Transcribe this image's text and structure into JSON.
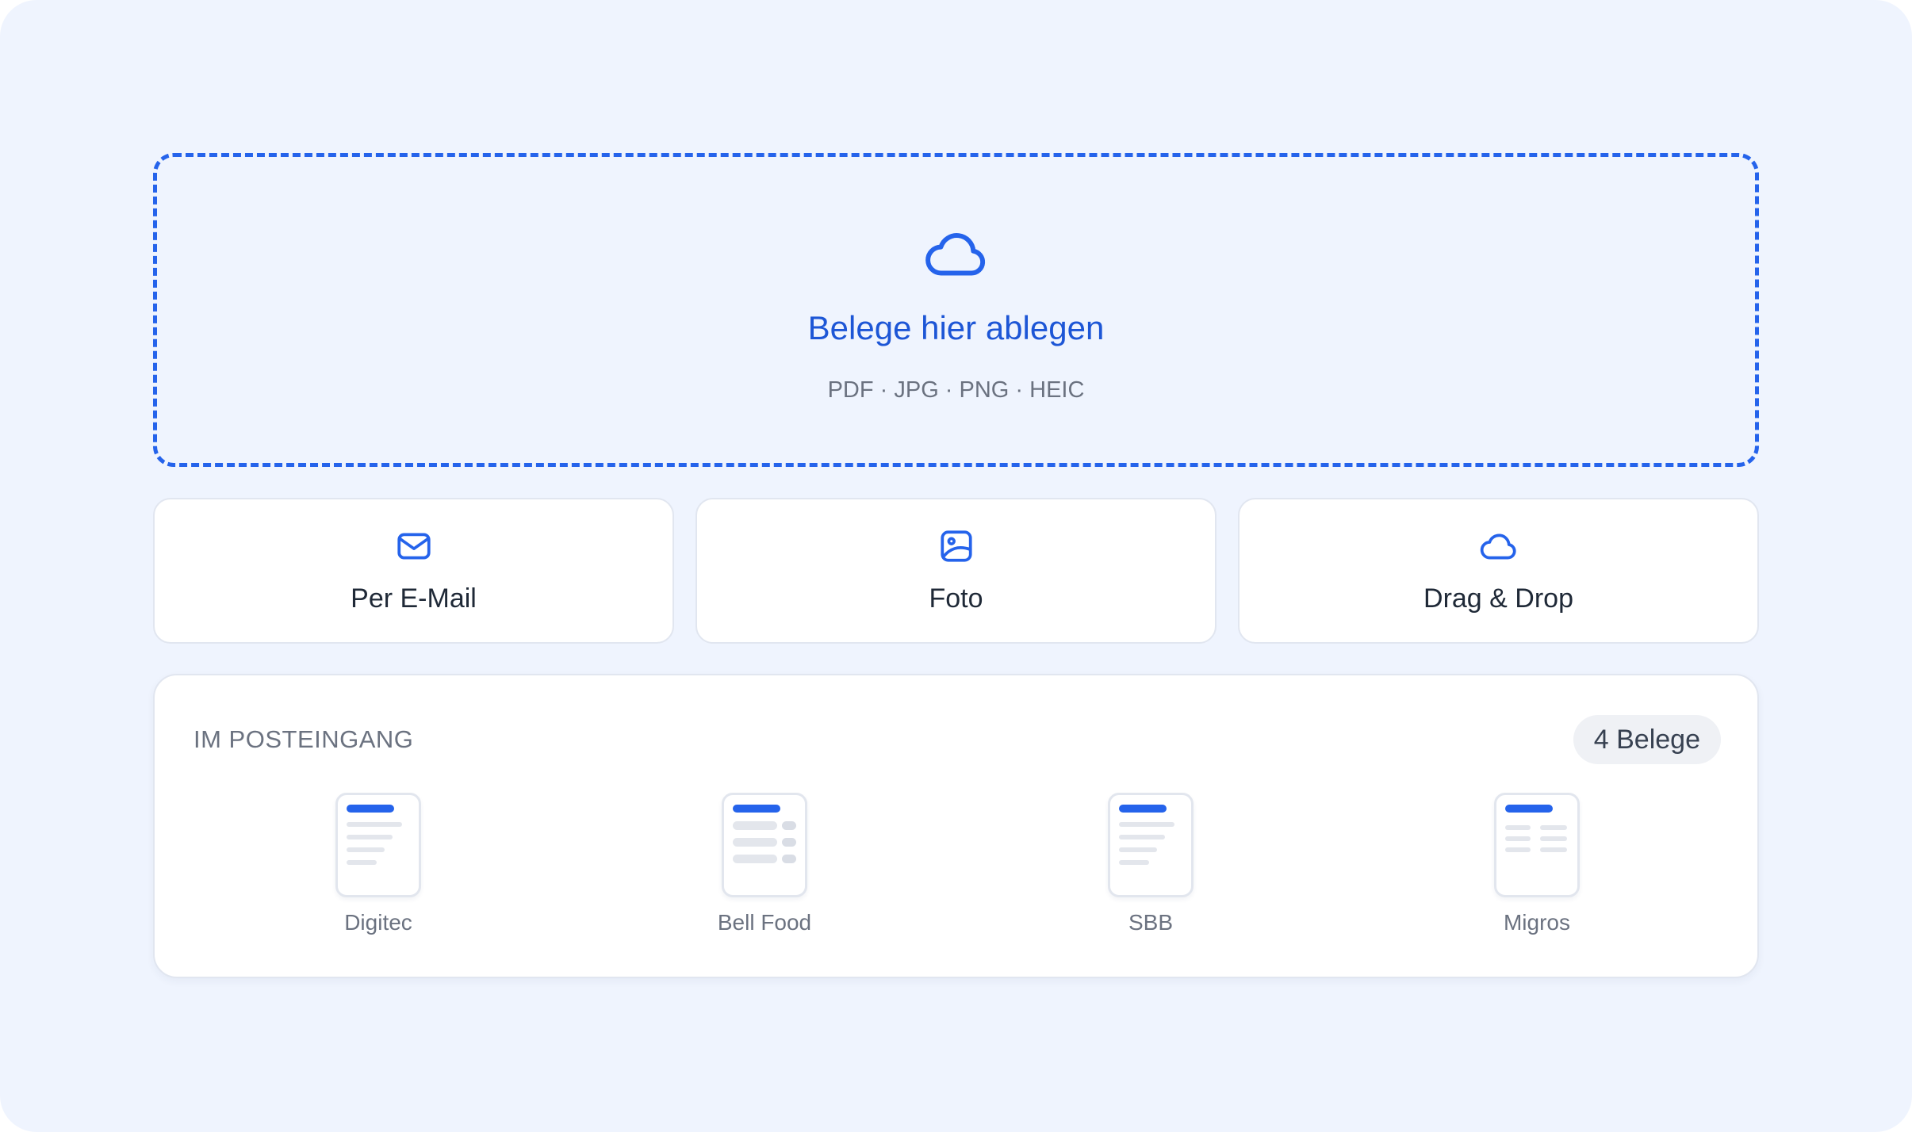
{
  "colors": {
    "background": "#eff4fe",
    "accent": "#2563eb",
    "accent_text": "#1d56d6"
  },
  "dropzone": {
    "icon": "cloud-icon",
    "title": "Belege hier ablegen",
    "formats": "PDF · JPG · PNG · HEIC"
  },
  "options": [
    {
      "icon": "mail-icon",
      "label": "Per E-Mail"
    },
    {
      "icon": "image-icon",
      "label": "Foto"
    },
    {
      "icon": "cloud-icon",
      "label": "Drag & Drop"
    }
  ],
  "inbox": {
    "heading": "IM POSTEINGANG",
    "count": "4 Belege",
    "receipts": [
      {
        "name": "Digitec",
        "icon": "document-lines-icon"
      },
      {
        "name": "Bell Food",
        "icon": "document-table-icon"
      },
      {
        "name": "SBB",
        "icon": "document-lines-icon"
      },
      {
        "name": "Migros",
        "icon": "document-columns-icon"
      }
    ]
  }
}
